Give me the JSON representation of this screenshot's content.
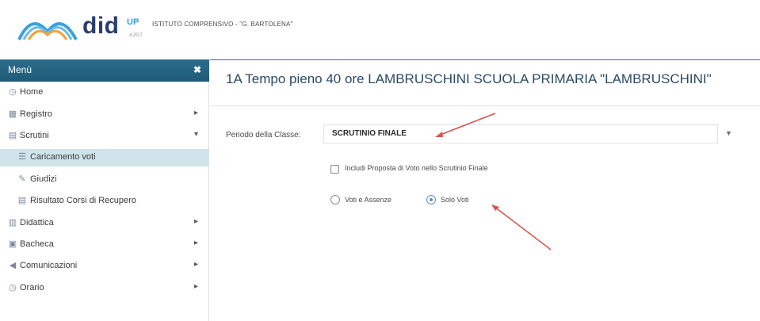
{
  "header": {
    "brand": "did",
    "brand_sup": "UP",
    "brand_version": "4.20.7",
    "school": "ISTITUTO COMPRENSIVO - \"G. BARTOLENA\""
  },
  "sidebar": {
    "title": "Menù",
    "close": "✖",
    "items": [
      {
        "label": "Home",
        "icon": "clock-icon"
      },
      {
        "label": "Registro",
        "icon": "calendar-icon"
      },
      {
        "label": "Scrutini",
        "icon": "document-icon"
      },
      {
        "label": "Caricamento voti",
        "icon": "list-icon"
      },
      {
        "label": "Giudizi",
        "icon": "edit-icon"
      },
      {
        "label": "Risultato Corsi di Recupero",
        "icon": "document-icon"
      },
      {
        "label": "Didattica",
        "icon": "book-icon"
      },
      {
        "label": "Bacheca",
        "icon": "board-icon"
      },
      {
        "label": "Comunicazioni",
        "icon": "megaphone-icon"
      },
      {
        "label": "Orario",
        "icon": "clock-icon"
      }
    ]
  },
  "main": {
    "title": "1A Tempo pieno 40 ore LAMBRUSCHINI SCUOLA PRIMARIA \"LAMBRUSCHINI\"",
    "periodo_label": "Periodo della Classe:",
    "periodo_value": "SCRUTINIO FINALE",
    "checkbox_label": "Includi Proposta di Voto nello Scrutinio Finale",
    "radio_voti_assenze": "Voti e Assenze",
    "radio_solo_voti": "Solo Voti"
  },
  "colors": {
    "menu_bar": "#2c6e8c",
    "active_item": "#cfe4ea",
    "annotation_arrow": "#d9534f"
  }
}
